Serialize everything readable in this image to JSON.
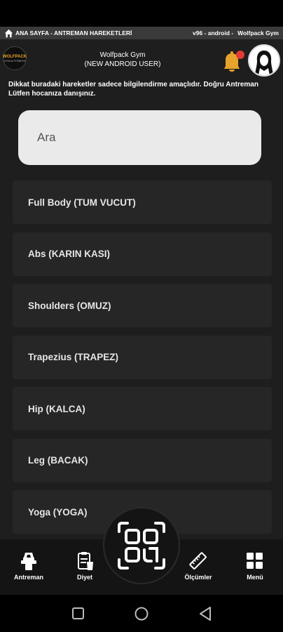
{
  "topbar": {
    "breadcrumb": "ANA SAYFA - ANTREMAN HAREKETLERİ",
    "version": "v96 - android -",
    "gym": "Wolfpack Gym"
  },
  "header": {
    "logo_text_1": "WOLFPACK",
    "logo_text_2": "GYM & FITNESS",
    "title_line1": "Wolfpack Gym",
    "title_line2": "(NEW ANDROID USER)"
  },
  "notice": "Dikkat buradaki hareketler sadece bilgilendirme amaçlıdır. Doğru Antreman Lütfen hocanıza danışınız.",
  "search": {
    "placeholder": "Ara"
  },
  "categories": [
    "Full Body (TUM VUCUT)",
    "Abs (KARIN KASI)",
    "Shoulders (OMUZ)",
    "Trapezius (TRAPEZ)",
    "Hip (KALCA)",
    "Leg (BACAK)",
    "Yoga (YOGA)"
  ],
  "nav": {
    "antreman": "Antreman",
    "diyet": "Diyet",
    "olcumler": "Ölçümler",
    "menu": "Menü"
  },
  "colors": {
    "background": "#1e1e1e",
    "card": "#262626",
    "accent": "#e7a32b",
    "notification": "#e53935"
  }
}
